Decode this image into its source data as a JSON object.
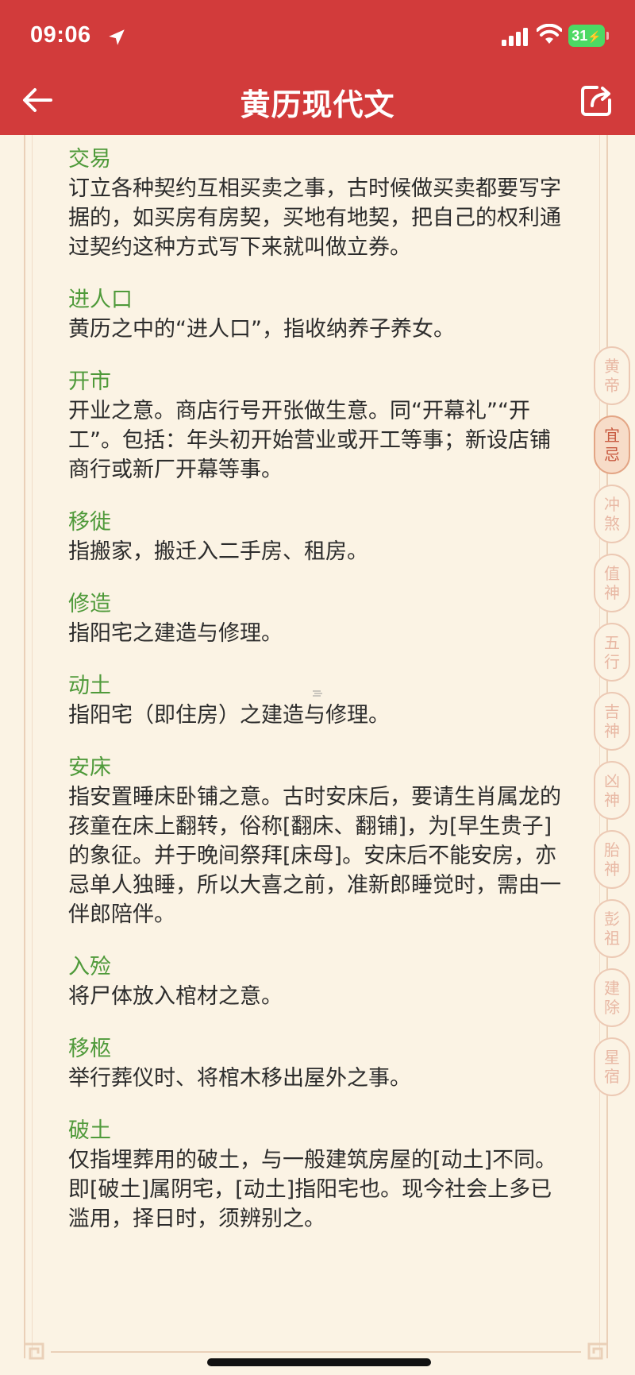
{
  "status_bar": {
    "time": "09:06",
    "battery": "31"
  },
  "header": {
    "title": "黄历现代文"
  },
  "entries": [
    {
      "term": "交易",
      "definition": "订立各种契约互相买卖之事，古时候做买卖都要写字据的，如买房有房契，买地有地契，把自己的权利通过契约这种方式写下来就叫做立券。"
    },
    {
      "term": "进人口",
      "definition": "黄历之中的“进人口”，指收纳养子养女。"
    },
    {
      "term": "开市",
      "definition": "开业之意。商店行号开张做生意。同“开幕礼”“开工”。包括：年头初开始营业或开工等事；新设店铺商行或新厂开幕等事。"
    },
    {
      "term": "移徙",
      "definition": "指搬家，搬迁入二手房、租房。"
    },
    {
      "term": "修造",
      "definition": "指阳宅之建造与修理。"
    },
    {
      "term": "动土",
      "definition": "指阳宅（即住房）之建造与修理。"
    },
    {
      "term": "安床",
      "definition": "指安置睡床卧铺之意。古时安床后，要请生肖属龙的孩童在床上翻转，俗称[翻床、翻铺]，为[早生贵子]的象征。并于晚间祭拜[床母]。安床后不能安房，亦忌单人独睡，所以大喜之前，准新郎睡觉时，需由一伴郎陪伴。"
    },
    {
      "term": "入殓",
      "definition": "将尸体放入棺材之意。"
    },
    {
      "term": "移柩",
      "definition": "举行葬仪时、将棺木移出屋外之事。"
    },
    {
      "term": "破土",
      "definition": "仅指埋葬用的破土，与一般建筑房屋的[动土]不同。即[破土]属阴宅，[动土]指阳宅也。现今社会上多已滥用，择日时，须辨别之。"
    }
  ],
  "side_nav": [
    {
      "top": "黄",
      "bottom": "帝"
    },
    {
      "top": "宜",
      "bottom": "忌"
    },
    {
      "top": "冲",
      "bottom": "煞"
    },
    {
      "top": "值",
      "bottom": "神"
    },
    {
      "top": "五",
      "bottom": "行"
    },
    {
      "top": "吉",
      "bottom": "神"
    },
    {
      "top": "凶",
      "bottom": "神"
    },
    {
      "top": "胎",
      "bottom": "神"
    },
    {
      "top": "彭",
      "bottom": "祖"
    },
    {
      "top": "建",
      "bottom": "除"
    },
    {
      "top": "星",
      "bottom": "宿"
    }
  ],
  "side_nav_active": 1,
  "colors": {
    "header_bg": "#d23b3b",
    "page_bg": "#fbf3e4",
    "term_green": "#4f9a3a",
    "active_tab": "#c85a40"
  }
}
